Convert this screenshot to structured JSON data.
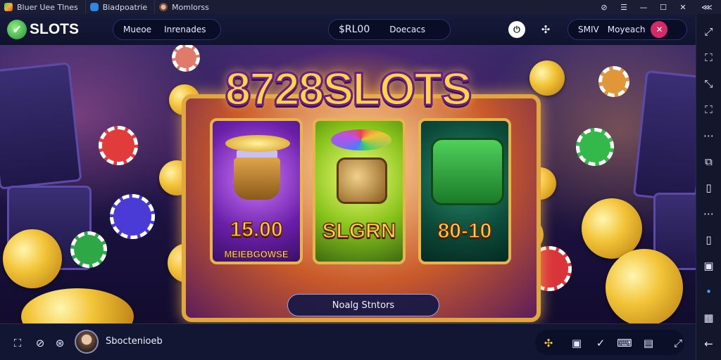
{
  "titlebar": {
    "tabs": [
      {
        "label": "Bluer Uee Tlnes"
      },
      {
        "label": "Biadpoatrie"
      },
      {
        "label": "Momlorss"
      }
    ],
    "buttons": [
      "notifications",
      "menu",
      "minimize",
      "maximize",
      "close"
    ]
  },
  "appbar": {
    "logo_text": "SLOTS",
    "nav": [
      "Mueoe",
      "Inrenades"
    ],
    "balance": "$RL00",
    "deposit_label": "Doecacs",
    "user_short": "SMIV",
    "user_action": "Moyeach"
  },
  "hero": {
    "title": "8728SLOTS",
    "cards": [
      {
        "value": "15.00",
        "sub": "MEIEBGOWSE"
      },
      {
        "value": "SLGRN",
        "sub": ""
      },
      {
        "value": "80-10",
        "sub": ""
      }
    ],
    "cta_label": "Noalg Stntors"
  },
  "bottombar": {
    "username": "Sboctenioeb"
  },
  "colors": {
    "bg": "#0d1030",
    "accent_gold": "#ffd447",
    "accent_purple": "#6a1f86",
    "logo_green": "#2fbf4a"
  }
}
